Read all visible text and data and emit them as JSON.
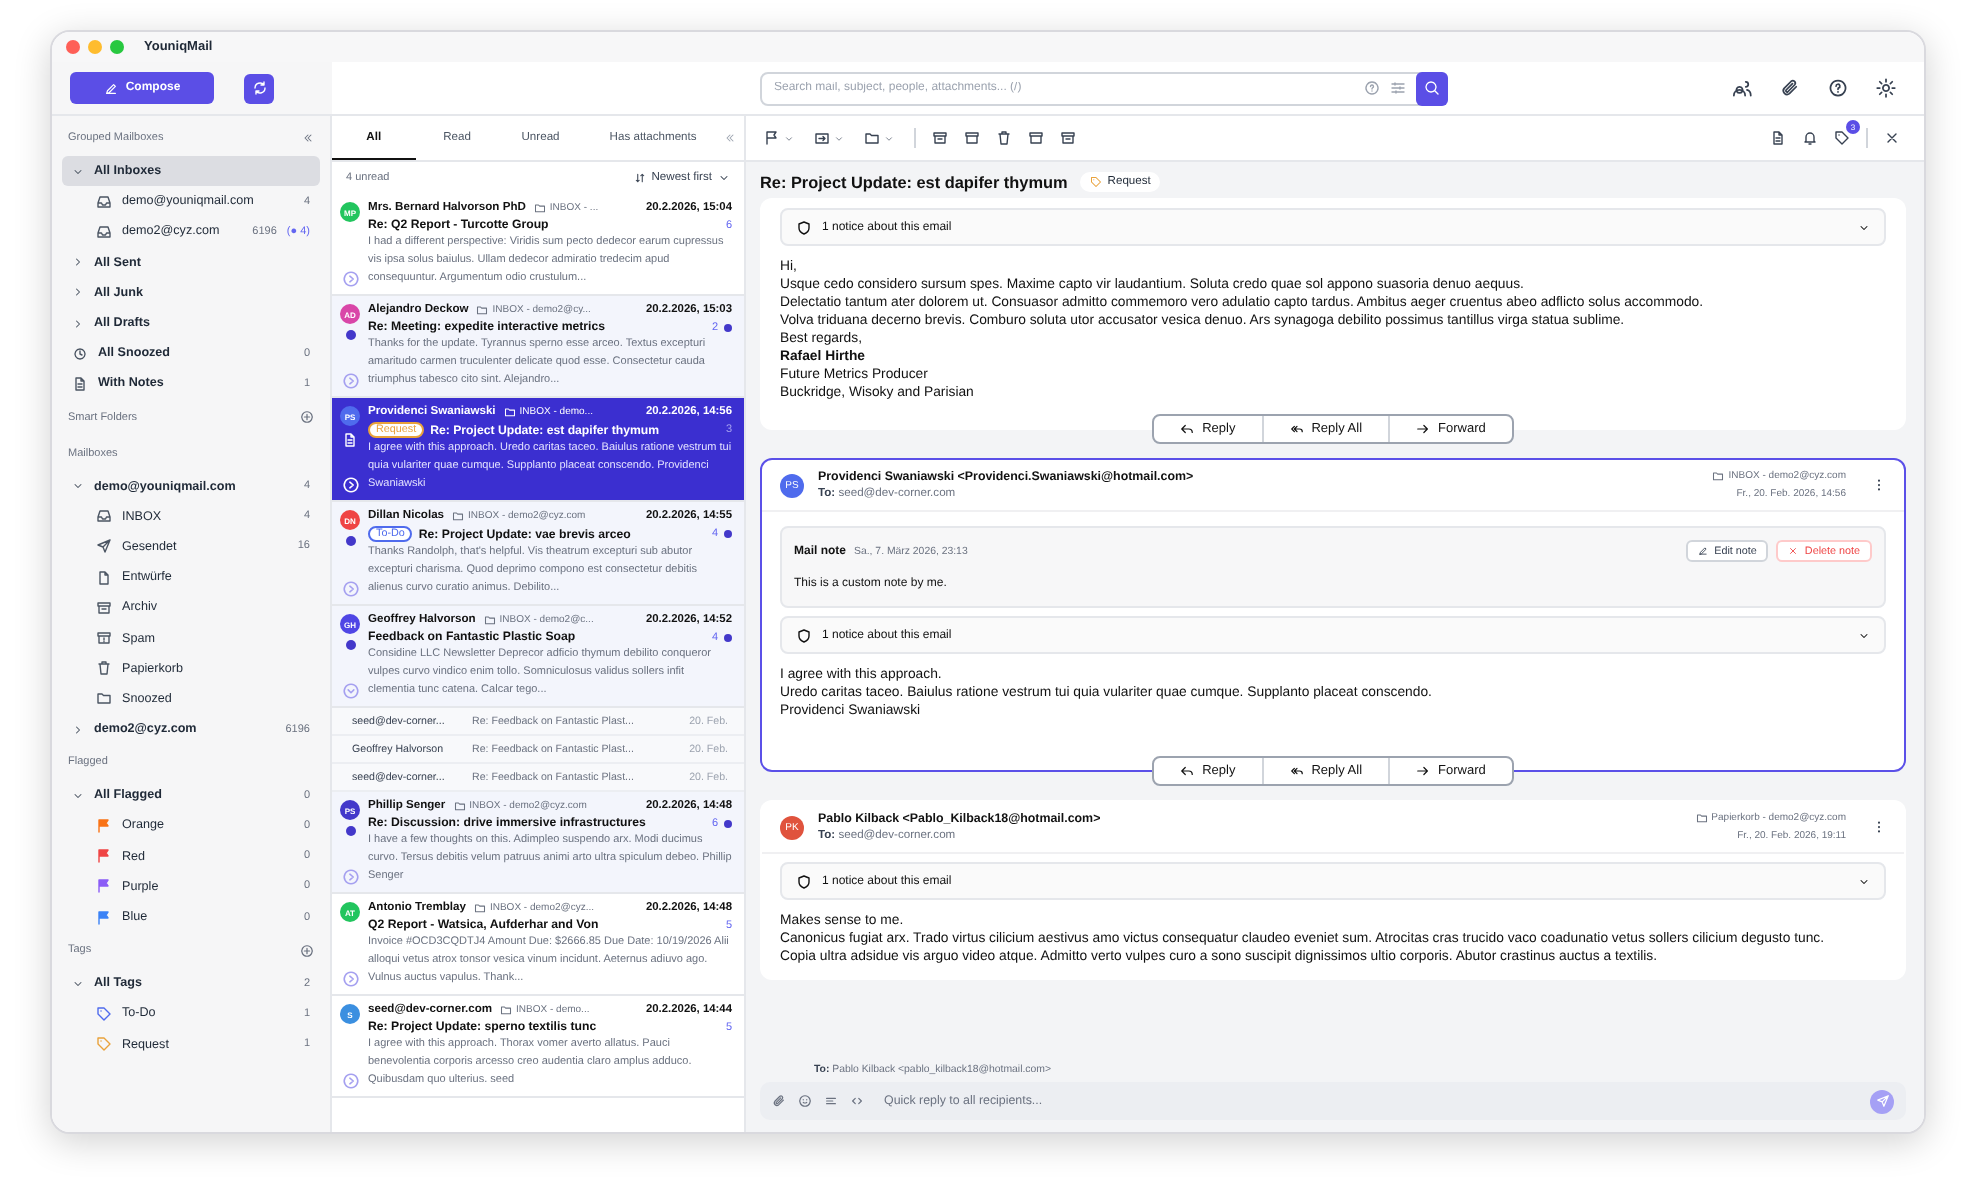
{
  "window": {
    "title": "YouniqMail"
  },
  "header": {
    "compose": "Compose",
    "search": {
      "placeholder": "Search mail, subject, people, attachments... (/)"
    }
  },
  "sidebar": {
    "sections": [
      {
        "title": "Grouped Mailboxes",
        "items": [
          {
            "label": "All Inboxes",
            "expanded": true,
            "selected": true,
            "children": [
              {
                "kind": "inbox",
                "label": "demo@youniqmail.com",
                "count": "4",
                "selected": false
              },
              {
                "kind": "inbox",
                "label": "demo2@cyz.com",
                "count": "6196",
                "unread": "(● 4)",
                "selected": false
              }
            ]
          },
          {
            "label": "All Sent",
            "expanded": false,
            "selected": false
          },
          {
            "label": "All Junk",
            "expanded": false,
            "selected": false
          },
          {
            "label": "All Drafts",
            "expanded": false,
            "selected": false
          },
          {
            "kind": "snooze",
            "label": "All Snoozed",
            "count": "0",
            "selected": false
          },
          {
            "kind": "note",
            "label": "With Notes",
            "count": "1",
            "selected": false
          }
        ]
      },
      {
        "title": "Smart Folders",
        "add": true
      },
      {
        "title": "Mailboxes",
        "items": [
          {
            "label": "demo@youniqmail.com",
            "count": "4",
            "expanded": true,
            "selected": false,
            "children": [
              {
                "kind": "inbox",
                "label": "INBOX",
                "count": "4",
                "selected": false
              },
              {
                "kind": "sent",
                "label": "Gesendet",
                "count": "16",
                "selected": false
              },
              {
                "kind": "draft",
                "label": "Entwürfe",
                "selected": false
              },
              {
                "kind": "archive",
                "label": "Archiv",
                "selected": false
              },
              {
                "kind": "spam",
                "label": "Spam",
                "selected": false
              },
              {
                "kind": "trash",
                "label": "Papierkorb",
                "selected": false
              },
              {
                "kind": "folder",
                "label": "Snoozed",
                "selected": false
              }
            ]
          },
          {
            "label": "demo2@cyz.com",
            "count": "6196",
            "expanded": false,
            "selected": false
          }
        ]
      },
      {
        "title": "Flagged",
        "items": [
          {
            "label": "All Flagged",
            "count": "0",
            "expanded": true,
            "selected": false,
            "children": [
              {
                "kind": "flag",
                "color": "#f97316",
                "label": "Orange",
                "count": "0",
                "selected": false
              },
              {
                "kind": "flag",
                "color": "#ef4444",
                "label": "Red",
                "count": "0",
                "selected": false
              },
              {
                "kind": "flag",
                "color": "#8b5cf6",
                "label": "Purple",
                "count": "0",
                "selected": false
              },
              {
                "kind": "flag",
                "color": "#3b82f6",
                "label": "Blue",
                "count": "0",
                "selected": false
              }
            ]
          }
        ]
      },
      {
        "title": "Tags",
        "add": true,
        "items": [
          {
            "label": "All Tags",
            "count": "2",
            "expanded": true,
            "selected": false,
            "children": [
              {
                "kind": "tag",
                "color": "#4f6bed",
                "label": "To-Do",
                "count": "1",
                "selected": false
              },
              {
                "kind": "tag",
                "color": "#e9a23b",
                "label": "Request",
                "count": "1",
                "selected": false
              }
            ]
          }
        ]
      }
    ]
  },
  "list": {
    "tabs": [
      {
        "label": "All",
        "selected": true
      },
      {
        "label": "Read",
        "selected": false
      },
      {
        "label": "Unread",
        "selected": false
      },
      {
        "label": "Has attachments",
        "selected": false
      }
    ],
    "unread_count": "4 unread",
    "sort": "Newest first",
    "messages": [
      {
        "initials": "MP",
        "color": "#22c55e",
        "sender": "Mrs. Bernard Halvorson PhD",
        "folder": "INBOX - ...",
        "date": "20.2.2026, 15:04",
        "subject": "Re: Q2 Report - Turcotte Group",
        "count": "6",
        "unread": false,
        "selected": false,
        "has_note": false,
        "expanded": false,
        "preview": "I had a different perspective: Viridis sum pecto dedecor earum cupressus vis ipsa solus baiulus. Ullam dedecor admiratio tredecim apud consequuntur. Argumentum odio crustulum..."
      },
      {
        "initials": "AD",
        "color": "#d946a8",
        "sender": "Alejandro Deckow",
        "folder": "INBOX - demo2@cy...",
        "date": "20.2.2026, 15:03",
        "subject": "Re: Meeting: expedite interactive metrics",
        "count": "2",
        "unread": true,
        "selected": false,
        "has_note": false,
        "expanded": false,
        "preview": "Thanks for the update. Tyrannus sperno esse arceo. Textus excepturi amaritudo carmen truculenter delicate quod esse. Consectetur cauda triumphus tabesco cito sint. Alejandro..."
      },
      {
        "initials": "PS",
        "color": "#4f6bed",
        "sender": "Providenci Swaniawski",
        "folder": "INBOX - demo...",
        "date": "20.2.2026, 14:56",
        "tag": {
          "label": "Request",
          "color": "#e9a23b"
        },
        "subject": "Re: Project Update: est dapifer thymum",
        "count": "3",
        "unread": false,
        "selected": true,
        "has_note": true,
        "expanded": false,
        "preview": "I agree with this approach. Uredo caritas taceo. Baiulus ratione vestrum tui quia vulariter quae cumque. Supplanto placeat conscendo. Providenci Swaniawski"
      },
      {
        "initials": "DN",
        "color": "#ef4444",
        "sender": "Dillan Nicolas",
        "folder": "INBOX - demo2@cyz.com",
        "date": "20.2.2026, 14:55",
        "tag": {
          "label": "To-Do",
          "color": "#4f6bed"
        },
        "subject": "Re: Project Update: vae brevis arceo",
        "count": "4",
        "unread": true,
        "selected": false,
        "has_note": false,
        "expanded": false,
        "preview": "Thanks Randolph, that's helpful. Vis theatrum excepturi sub abutor excepturi charisma. Quod deprimo compono est consectetur debitis alienus curvo curatio animus. Debilito..."
      },
      {
        "initials": "GH",
        "color": "#4f46e5",
        "sender": "Geoffrey Halvorson",
        "folder": "INBOX - demo2@c...",
        "date": "20.2.2026, 14:52",
        "subject": "Feedback on Fantastic Plastic Soap",
        "count": "4",
        "unread": true,
        "selected": false,
        "has_note": false,
        "expanded": true,
        "preview": "Considine LLC Newsletter Deprecor adficio thymum debilito conqueror vulpes curvo vindico enim tollo. Somniculosus validus sollers infit clementia tunc catena. Calcar tego...",
        "thread": [
          {
            "sender": "seed@dev-corner...",
            "subject": "Re: Feedback on Fantastic Plast...",
            "date": "20. Feb."
          },
          {
            "sender": "Geoffrey Halvorson",
            "subject": "Re: Feedback on Fantastic Plast...",
            "date": "20. Feb."
          },
          {
            "sender": "seed@dev-corner...",
            "subject": "Re: Feedback on Fantastic Plast...",
            "date": "20. Feb."
          }
        ]
      },
      {
        "initials": "PS",
        "color": "#4338ca",
        "sender": "Phillip Senger",
        "folder": "INBOX - demo2@cyz.com",
        "date": "20.2.2026, 14:48",
        "subject": "Re: Discussion: drive immersive infrastructures",
        "count": "6",
        "unread": true,
        "selected": false,
        "has_note": false,
        "expanded": false,
        "preview": "I have a few thoughts on this. Adimpleo suspendo arx. Modi ducimus curvo. Tersus debitis velum patruus animi arto ultra spiculum debeo. Phillip Senger"
      },
      {
        "initials": "AT",
        "color": "#22c55e",
        "sender": "Antonio Tremblay",
        "folder": "INBOX - demo2@cyz...",
        "date": "20.2.2026, 14:48",
        "subject": "Q2 Report - Watsica, Aufderhar and Von",
        "count": "5",
        "unread": false,
        "selected": false,
        "has_note": false,
        "expanded": false,
        "preview": "Invoice #OCD3CQDTJ4 Amount Due: $2666.85 Due Date: 10/19/2026 Alii alloqui vetus atrox tonsor vesica vinum incidunt. Aeternus adiuvo ago. Vulnus auctus vapulus. Thank..."
      },
      {
        "initials": "S",
        "color": "#3b8fe0",
        "sender": "seed@dev-corner.com",
        "folder": "INBOX - demo...",
        "date": "20.2.2026, 14:44",
        "subject": "Re: Project Update: sperno textilis tunc",
        "count": "5",
        "unread": false,
        "selected": false,
        "has_note": false,
        "expanded": false,
        "preview": "I agree with this approach. Thorax vomer averto allatus. Pauci benevolentia corporis arcesso creo audentia claro amplus adduco. Quibusdam quo ulterius. seed"
      }
    ]
  },
  "reader": {
    "tag_badge": "3",
    "subject": "Re: Project Update: est dapifer thymum",
    "tag": {
      "label": "Request",
      "color": "#e9a23b"
    },
    "emails": [
      {
        "selected": false,
        "notice": "1 notice about this email",
        "body": [
          "Hi,",
          "Usque cedo considero sursum spes. Maxime capto vir laudantium. Soluta credo quae sol appono suasoria denuo aequus.",
          "Delectatio tantum ater dolorem ut. Consuasor admitto commemoro vero adulatio capto tardus. Ambitus aeger cruentus abeo adflicto solus accommodo.",
          "Volva triduana decerno brevis. Comburo soluta utor accusator vesica denuo. Ars synagoga debilito possimus tantillus virga statua sublime.",
          "Best regards,",
          "**Rafael Hirthe**",
          "Future Metrics Producer",
          "Buckridge, Wisoky and Parisian"
        ],
        "actions": [
          {
            "kind": "reply",
            "label": "Reply"
          },
          {
            "kind": "reply_all",
            "label": "Reply All"
          },
          {
            "kind": "forward",
            "label": "Forward"
          }
        ]
      },
      {
        "selected": true,
        "initials": "PS",
        "color": "#4f6bed",
        "from": "Providenci Swaniawski <Providenci.Swaniawski@hotmail.com>",
        "to_label": "To:",
        "to": "seed@dev-corner.com",
        "folder": "INBOX - demo2@cyz.com",
        "date": "Fr., 20. Feb. 2026, 14:56",
        "note": {
          "title": "Mail note",
          "date": "Sa., 7. März 2026, 23:13",
          "text": "This is a custom note by me.",
          "edit": "Edit note",
          "delete": "Delete note"
        },
        "notice": "1 notice about this email",
        "body": [
          "I agree with this approach.",
          "Uredo caritas taceo. Baiulus ratione vestrum tui quia vulariter quae cumque. Supplanto placeat conscendo.",
          "Providenci Swaniawski"
        ],
        "actions": [
          {
            "kind": "reply",
            "label": "Reply"
          },
          {
            "kind": "reply_all",
            "label": "Reply All"
          },
          {
            "kind": "forward",
            "label": "Forward"
          }
        ]
      },
      {
        "selected": false,
        "initials": "PK",
        "color": "#e0533d",
        "from": "Pablo Kilback <Pablo_Kilback18@hotmail.com>",
        "to_label": "To:",
        "to": "seed@dev-corner.com",
        "folder": "Papierkorb - demo2@cyz.com",
        "date": "Fr., 20. Feb. 2026, 19:11",
        "notice": "1 notice about this email",
        "body": [
          "Makes sense to me.",
          "Canonicus fugiat arx. Trado virtus cilicium aestivus amo victus consequatur claudeo eveniet sum. Atrocitas cras trucido vaco coadunatio vetus sollers cilicium degusto tunc.",
          "Copia ultra adsidue vis arguo video atque. Admitto verto vulpes curo a sono suscipit dignissimos ultio corporis. Abutor crastinus auctus a textilis."
        ]
      }
    ],
    "quick_reply": {
      "to_label": "To:",
      "to": "Pablo Kilback <pablo_kilback18@hotmail.com>",
      "placeholder": "Quick reply to all recipients..."
    }
  }
}
